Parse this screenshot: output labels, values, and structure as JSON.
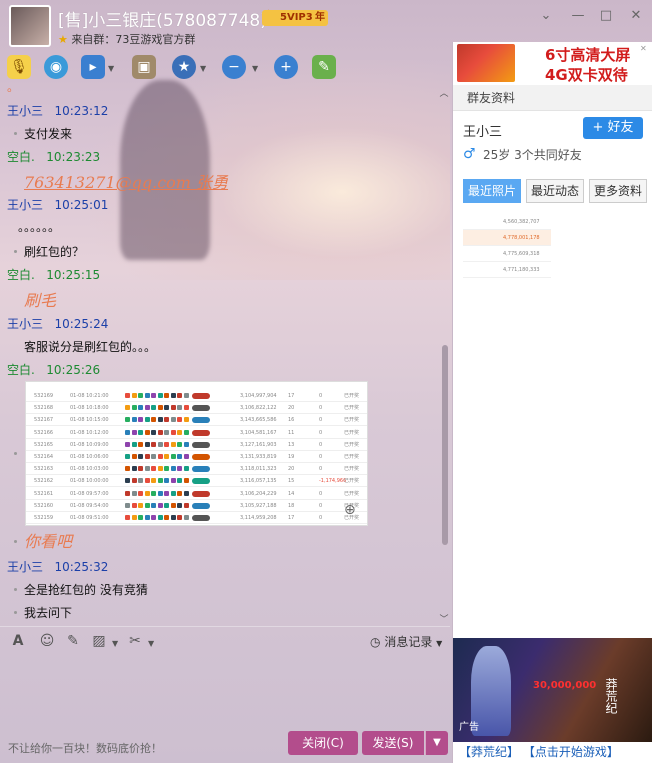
{
  "window": {
    "title": "[售]小三银庄(578087748)",
    "vip_badge": "5VIP3",
    "vip_year": "年",
    "subtitle": "来自群：73豆游戏官方群",
    "buttons": {
      "minimize": "—",
      "maximize": "□",
      "close": "✕",
      "dropdown": "⌄"
    }
  },
  "toolbar": {
    "icons": [
      "microphone-icon",
      "video-icon",
      "file-transfer-icon",
      "screen-capture-icon",
      "app-store-icon",
      "remove-member-icon",
      "add-member-icon",
      "comment-icon"
    ]
  },
  "chat": {
    "messages": [
      {
        "sender": "王小三",
        "time": "10:23:12",
        "text": "支付发来"
      },
      {
        "sender": "空白.",
        "time": "10:23:23"
      },
      {
        "signature": "763413271@qq.com 张勇"
      },
      {
        "sender": "王小三",
        "time": "10:25:01",
        "lines": [
          "。。。。。。",
          "刷红包的？"
        ]
      },
      {
        "sender": "空白.",
        "time": "10:25:15"
      },
      {
        "signature": "刷毛"
      },
      {
        "sender": "王小三",
        "time": "10:25:24",
        "text": "客服说分是刷红包的。。。"
      },
      {
        "sender": "空白.",
        "time": "10:25:26"
      },
      {
        "signature": "你看吧"
      },
      {
        "sender": "王小三",
        "time": "10:25:32",
        "lines": [
          "全是抢红包的 没有竞猜",
          "我去问下"
        ]
      }
    ],
    "screenshot_rows": [
      [
        "532169",
        "01-08 10:21:00",
        "3,104,997,904",
        "17",
        "0"
      ],
      [
        "532168",
        "01-08 10:18:00",
        "3,106,822,122",
        "20",
        "0"
      ],
      [
        "532167",
        "01-08 10:15:00",
        "3,143,665,586",
        "16",
        "0"
      ],
      [
        "532166",
        "01-08 10:12:00",
        "3,104,581,167",
        "11",
        "0"
      ],
      [
        "532165",
        "01-08 10:09:00",
        "3,127,161,903",
        "13",
        "0"
      ],
      [
        "532164",
        "01-08 10:06:00",
        "3,131,933,819",
        "19",
        "0"
      ],
      [
        "532163",
        "01-08 10:03:00",
        "3,118,011,323",
        "20",
        "0"
      ],
      [
        "532162",
        "01-08 10:00:00",
        "3,116,057,135",
        "15",
        "-1,174,966"
      ],
      [
        "532161",
        "01-08 09:57:00",
        "3,106,204,229",
        "14",
        "0"
      ],
      [
        "532160",
        "01-08 09:54:00",
        "3,105,927,188",
        "18",
        "0"
      ],
      [
        "532159",
        "01-08 09:51:00",
        "3,114,959,208",
        "17",
        "0"
      ]
    ],
    "screenshot_status": "已开奖"
  },
  "input_toolbar": {
    "history_label": "消息记录"
  },
  "bottom": {
    "ad_text": "不让给你一百块！数码底价抢！",
    "close_label": "关闭(C)",
    "send_label": "发送(S)"
  },
  "right_panel": {
    "ad_banner": {
      "line1": "6寸高清大屏",
      "line2": "4G双卡双待"
    },
    "section_title": "群友资料",
    "profile": {
      "name": "王小三",
      "add_friend": "+ 好友",
      "info": "25岁  3个共同好友"
    },
    "tabs": [
      "最近照片",
      "最近动态",
      "更多资料"
    ],
    "recent_rows": [
      "4,560,382,707",
      "4,778,001,178",
      "4,775,609,318",
      "4,771,180,333"
    ],
    "game_ad": {
      "score": "30,000,000",
      "vertical": "莽荒纪",
      "ad_label": "广告",
      "link1": "【莽荒纪】",
      "link2": "【点击开始游戏】"
    }
  }
}
